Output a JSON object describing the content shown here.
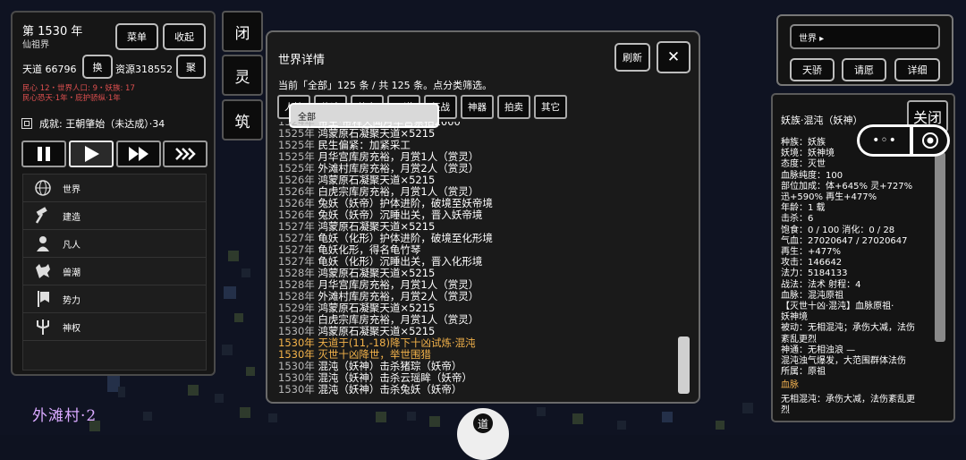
{
  "left_panel": {
    "year": "第 1530 年",
    "realm": "仙祖界",
    "menu_button": "菜单",
    "collapse_button": "收起",
    "tiandao": "天道 66796",
    "swap_button": "换",
    "resources": "资源318552",
    "gather_button": "聚",
    "red_line_1": "民心 12・世界人口: 9・妖族: 17",
    "red_line_2": "民心恐天·1年・庇护骄纵·1年",
    "achievement": "成就: 王朝肇始（未达成）·34",
    "menu_items": [
      {
        "label": "世界",
        "icon": "globe-icon"
      },
      {
        "label": "建造",
        "icon": "hammer-icon"
      },
      {
        "label": "凡人",
        "icon": "person-icon"
      },
      {
        "label": "兽潮",
        "icon": "wolf-icon"
      },
      {
        "label": "势力",
        "icon": "banner-icon"
      },
      {
        "label": "神权",
        "icon": "trident-icon"
      }
    ]
  },
  "side_buttons": [
    "闭",
    "灵",
    "筑"
  ],
  "map": {
    "village_label": "外滩村·2",
    "bottom_button": "道"
  },
  "world_detail": {
    "title": "世界详情",
    "refresh_button": "刷新",
    "close_button": "✕",
    "subtitle": "当前「全部」125 条 / 共 125 条。点分类筛选。",
    "filters": [
      "全部",
      "人情",
      "修途",
      "势力",
      "天道",
      "征战",
      "神器",
      "拍卖",
      "其它"
    ],
    "selected_filter": "全部",
    "log": [
      {
        "year": "1524年",
        "text": "帝主·帝释天闻月华宫票拍2000",
        "hl": false
      },
      {
        "year": "1525年",
        "text": "鸿蒙原石凝聚天道×5215",
        "hl": false
      },
      {
        "year": "1525年",
        "text": "民生偏紧：加紧采工",
        "hl": false
      },
      {
        "year": "1525年",
        "text": "月华宫库房充裕，月赏1人（赏灵）",
        "hl": false
      },
      {
        "year": "1525年",
        "text": "外滩村库房充裕，月赏2人（赏灵）",
        "hl": false
      },
      {
        "year": "1526年",
        "text": "鸿蒙原石凝聚天道×5215",
        "hl": false
      },
      {
        "year": "1526年",
        "text": "白虎宗库房充裕，月赏1人（赏灵）",
        "hl": false
      },
      {
        "year": "1526年",
        "text": "兔妖（妖帝）护体进阶，破境至妖帝境",
        "hl": false
      },
      {
        "year": "1526年",
        "text": "兔妖（妖帝）沉睡出关，晋入妖帝境",
        "hl": false
      },
      {
        "year": "1527年",
        "text": "鸿蒙原石凝聚天道×5215",
        "hl": false
      },
      {
        "year": "1527年",
        "text": "龟妖（化形）护体进阶，破境至化形境",
        "hl": false
      },
      {
        "year": "1527年",
        "text": "龟妖化形，得名龟竹琴",
        "hl": false
      },
      {
        "year": "1527年",
        "text": "龟妖（化形）沉睡出关，晋入化形境",
        "hl": false
      },
      {
        "year": "1528年",
        "text": "鸿蒙原石凝聚天道×5215",
        "hl": false
      },
      {
        "year": "1528年",
        "text": "月华宫库房充裕，月赏1人（赏灵）",
        "hl": false
      },
      {
        "year": "1528年",
        "text": "外滩村库房充裕，月赏2人（赏灵）",
        "hl": false
      },
      {
        "year": "1529年",
        "text": "鸿蒙原石凝聚天道×5215",
        "hl": false
      },
      {
        "year": "1529年",
        "text": "白虎宗库房充裕，月赏1人（赏灵）",
        "hl": false
      },
      {
        "year": "1530年",
        "text": "鸿蒙原石凝聚天道×5215",
        "hl": false
      },
      {
        "year": "1530年",
        "text": "天道于(11,-18)降下十凶试炼·混沌",
        "hl": true
      },
      {
        "year": "1530年",
        "text": "灭世十凶降世，举世围猎",
        "hl": true
      },
      {
        "year": "1530年",
        "text": "混沌（妖神）击杀猪琮（妖帝）",
        "hl": false
      },
      {
        "year": "1530年",
        "text": "混沌（妖神）击杀云瑶眸（妖帝）",
        "hl": false
      },
      {
        "year": "1530年",
        "text": "混沌（妖神）击杀兔妖（妖帝）",
        "hl": false
      }
    ]
  },
  "right_top": {
    "selector": "世界 ▸",
    "buttons": [
      "天骄",
      "请愿",
      "详细"
    ]
  },
  "right_info": {
    "title": "妖族·混沌（妖神）",
    "close_button": "关闭",
    "pill_left": "•◦•",
    "attrs": [
      {
        "text": "种族：妖族",
        "sec": false
      },
      {
        "text": "妖境：妖神境",
        "sec": false
      },
      {
        "text": "态度：灭世",
        "sec": false
      },
      {
        "text": "血脉纯度：100",
        "sec": false
      },
      {
        "text": "部位加成：体+645% 灵+727%",
        "sec": false
      },
      {
        "text": "迅+590% 再生+477%",
        "sec": false
      },
      {
        "text": "年龄：1 载",
        "sec": false
      },
      {
        "text": "击杀：6",
        "sec": false
      },
      {
        "text": "饱食：0 / 100  消化：0 / 28",
        "sec": false
      },
      {
        "text": "气血：27020647 / 27020647",
        "sec": false
      },
      {
        "text": "再生：+477%",
        "sec": false
      },
      {
        "text": "攻击：146642",
        "sec": false
      },
      {
        "text": "法力：5184133",
        "sec": false
      },
      {
        "text": "战法：法术  射程：4",
        "sec": false
      },
      {
        "text": "血脉：混沌原祖",
        "sec": false
      },
      {
        "text": "【灭世十凶·混沌】血脉原祖·",
        "sec": false
      },
      {
        "text": "妖神境",
        "sec": false
      },
      {
        "text": "被动：无相混沌；承伤大减，法伤",
        "sec": false
      },
      {
        "text": "紊乱更烈",
        "sec": false
      },
      {
        "text": "神通：无相浊浪 —",
        "sec": false
      },
      {
        "text": "混沌浊气爆发，大范围群体法伤",
        "sec": false
      },
      {
        "text": "所属：原祖",
        "sec": false
      },
      {
        "text": "血脉",
        "sec": true
      },
      {
        "text": "无相混沌：承伤大减，法伤紊乱更",
        "sec": false
      },
      {
        "text": "烈",
        "sec": false
      }
    ]
  }
}
